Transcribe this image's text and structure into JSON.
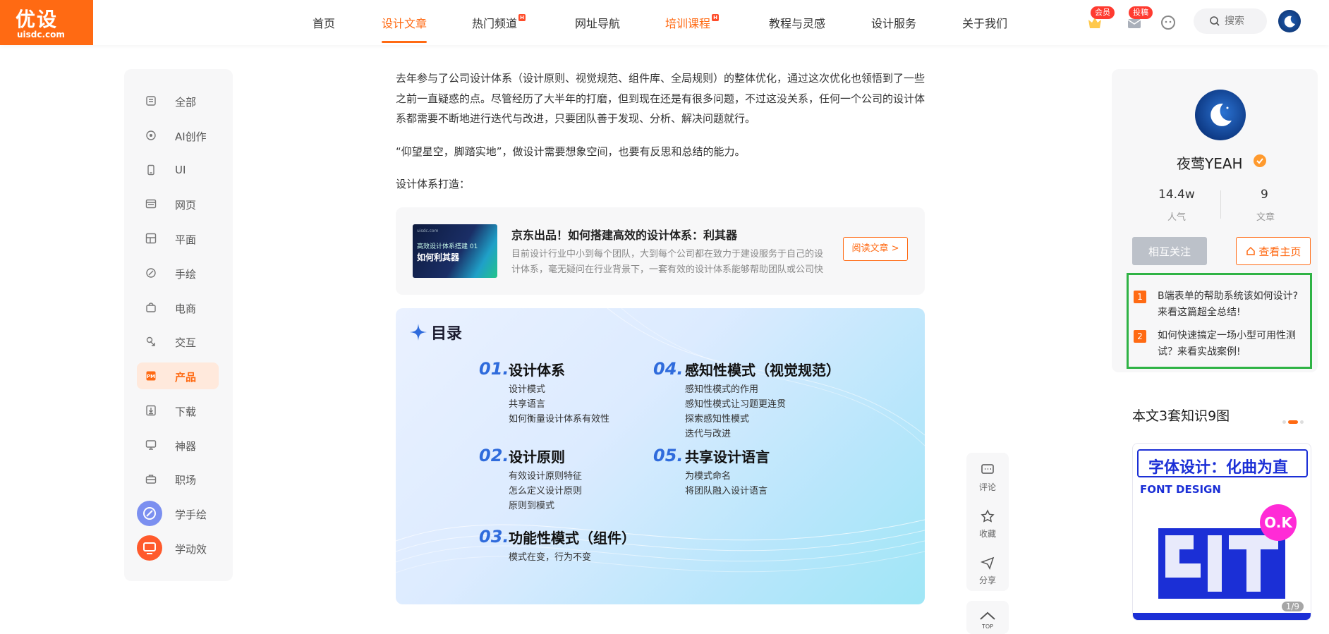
{
  "logo": {
    "name": "优设",
    "domain": "uisdc.com"
  },
  "nav": {
    "items": [
      {
        "label": "首页"
      },
      {
        "label": "设计文章"
      },
      {
        "label": "热门频道"
      },
      {
        "label": "网址导航"
      },
      {
        "label": "培训课程"
      },
      {
        "label": "教程与灵感"
      },
      {
        "label": "设计服务"
      },
      {
        "label": "关于我们"
      }
    ],
    "hot_badge": "H",
    "member_badge": "会员",
    "submit_badge": "投稿",
    "search_placeholder": "搜索",
    "accent_color": "#ff6a13"
  },
  "sidebar": {
    "items": [
      {
        "label": "全部",
        "icon": "all-icon"
      },
      {
        "label": "AI创作",
        "icon": "ai-icon"
      },
      {
        "label": "UI",
        "icon": "ui-icon"
      },
      {
        "label": "网页",
        "icon": "web-icon"
      },
      {
        "label": "平面",
        "icon": "layout-icon"
      },
      {
        "label": "手绘",
        "icon": "brush-icon"
      },
      {
        "label": "电商",
        "icon": "shop-bag-icon"
      },
      {
        "label": "交互",
        "icon": "interaction-icon"
      },
      {
        "label": "产品",
        "icon": "product-icon"
      },
      {
        "label": "下载",
        "icon": "download-icon"
      },
      {
        "label": "神器",
        "icon": "tool-icon"
      },
      {
        "label": "职场",
        "icon": "briefcase-icon"
      },
      {
        "label": "学手绘",
        "icon": "learn-draw-icon"
      },
      {
        "label": "学动效",
        "icon": "learn-motion-icon"
      }
    ],
    "active": "产品"
  },
  "article": {
    "p1_line1": "去年参与了公司设计体系（设计原则、视觉规范、组件库、全局规则）的整体优化，通过这次优化也领悟到了一些",
    "p1_line2": "之前一直疑惑的点。尽管经历了大半年的打磨，但到现在还是有很多问题，不过这没关系，任何一个公司的设计体",
    "p1_line3": "系都需要不断地进行迭代与改进，只要团队善于发现、分析、解决问题就行。",
    "p2": "“仰望星空，脚踏实地”，做设计需要想象空间，也要有反思和总结的能力。",
    "p3": "设计体系打造：",
    "card": {
      "thumb_top": "uisdc.com",
      "thumb_series": "高效设计体系搭建 01",
      "thumb_title": "如何利其器",
      "title": "京东出品！如何搭建高效的设计体系：利其器",
      "desc": "目前设计行业中小到每个团队，大到每个公司都在致力于建设服务于自己的设计体系，毫无疑问在行业背景下，一套有效的设计体系能够帮助团队或公司快",
      "button": "阅读文章 >"
    },
    "toc": {
      "title": "目录",
      "sections": [
        {
          "num": "01.",
          "title": "设计体系",
          "subs": [
            "设计模式",
            "共享语言",
            "如何衡量设计体系有效性"
          ]
        },
        {
          "num": "02.",
          "title": "设计原则",
          "subs": [
            "有效设计原则特征",
            "怎么定义设计原则",
            "原则到模式"
          ]
        },
        {
          "num": "03.",
          "title": "功能性模式（组件）",
          "subs": [
            "模式在变，行为不变"
          ]
        },
        {
          "num": "04.",
          "title": "感知性模式（视觉规范）",
          "subs": [
            "感知性模式的作用",
            "感知性模式让习题更连贯",
            "探索感知性模式",
            "迭代与改进"
          ]
        },
        {
          "num": "05.",
          "title": "共享设计语言",
          "subs": [
            "为模式命名",
            "将团队融入设计语言"
          ]
        }
      ]
    }
  },
  "float_actions": {
    "comment": "评论",
    "favorite": "收藏",
    "share": "分享",
    "top": "TOP"
  },
  "author": {
    "name": "夜莺YEAH",
    "popularity_value": "14.4w",
    "popularity_label": "人气",
    "articles_value": "9",
    "articles_label": "文章",
    "follow_button": "相互关注",
    "home_button": "查看主页"
  },
  "recommend": [
    {
      "num": "1",
      "line1": "B端表单的帮助系统该如何设计?",
      "line2": "来看这篇超全总结!"
    },
    {
      "num": "2",
      "line1": "如何快速搞定一场小型可用性测",
      "line2": "试？来看实战案例!"
    }
  ],
  "knowledge": {
    "title": "本文3套知识9图",
    "poster_head": "字体设计：化曲为直",
    "poster_sub": "FONT DESIGN",
    "poster_ok": "O.K",
    "page_indicator": "1/9"
  }
}
